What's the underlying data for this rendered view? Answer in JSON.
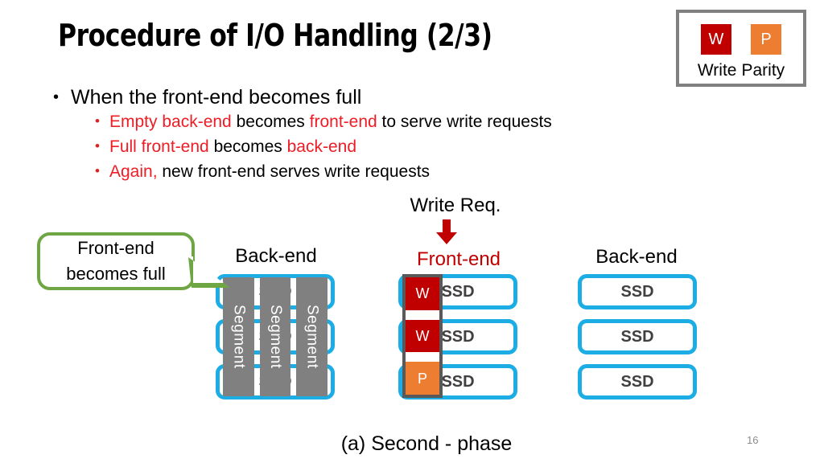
{
  "slide": {
    "title": "Procedure of I/O Handling (2/3)",
    "caption": "(a) Second - phase",
    "page_number": "16"
  },
  "legend": {
    "write_chip": "W",
    "parity_chip": "P",
    "write_label": "Write",
    "parity_label": "Parity",
    "write_color": "#C00000",
    "parity_color": "#ED7D31",
    "border_color": "#808080"
  },
  "bullets": {
    "main": "When the front-end becomes full",
    "sub": [
      {
        "parts": [
          {
            "text": "Empty back-end",
            "color": "red"
          },
          {
            "text": " becomes ",
            "color": "black"
          },
          {
            "text": "front-end",
            "color": "red"
          },
          {
            "text": " to serve write requests",
            "color": "black"
          }
        ]
      },
      {
        "parts": [
          {
            "text": "Full front-end",
            "color": "red"
          },
          {
            "text": " becomes ",
            "color": "black"
          },
          {
            "text": "back-end",
            "color": "red"
          }
        ]
      },
      {
        "parts": [
          {
            "text": "Again,",
            "color": "red"
          },
          {
            "text": " new front-end serves write requests",
            "color": "black"
          }
        ]
      }
    ],
    "red_color": "#EE1C25"
  },
  "diagram": {
    "callout": {
      "line1": "Front-end",
      "line2": "becomes full",
      "border_color": "#6FA644"
    },
    "write_request": {
      "label": "Write Req.",
      "arrow_color": "#C00000"
    },
    "columns": [
      {
        "id": "back-end-left",
        "title": "Back-end",
        "title_color": "#000000",
        "ssd_labels": [
          "SSD",
          "SSD",
          "SSD"
        ],
        "segments": [
          "Segment",
          "Segment",
          "Segment"
        ],
        "segment_color": "#808080"
      },
      {
        "id": "front-end",
        "title": "Front-end",
        "title_color": "#C00000",
        "ssd_labels": [
          "SSD",
          "SSD",
          "SSD"
        ],
        "blocks": [
          {
            "label": "W",
            "color": "#C00000"
          },
          {
            "label": "W",
            "color": "#C00000"
          },
          {
            "label": "P",
            "color": "#ED7D31"
          }
        ]
      },
      {
        "id": "back-end-right",
        "title": "Back-end",
        "title_color": "#000000",
        "ssd_labels": [
          "SSD",
          "SSD",
          "SSD"
        ]
      }
    ],
    "ssd_border_color": "#1CADE4"
  }
}
